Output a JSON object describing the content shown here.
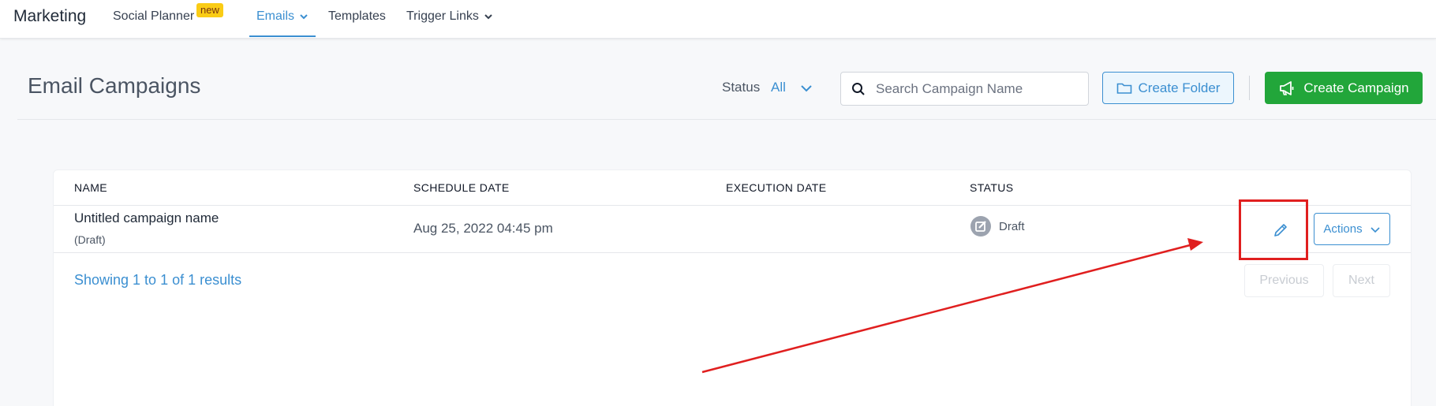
{
  "nav": {
    "brand": "Marketing",
    "items": [
      {
        "label": "Social Planner",
        "badge": "new"
      },
      {
        "label": "Emails",
        "active": true
      },
      {
        "label": "Templates"
      },
      {
        "label": "Trigger Links"
      }
    ],
    "accent_color": "#3b8fd1"
  },
  "header": {
    "title": "Email Campaigns",
    "status_label": "Status",
    "status_value": "All",
    "search_placeholder": "Search Campaign Name",
    "create_folder_label": "Create Folder",
    "create_campaign_label": "Create Campaign",
    "create_campaign_color": "#22a63a"
  },
  "table": {
    "columns": [
      "NAME",
      "SCHEDULE DATE",
      "EXECUTION DATE",
      "STATUS"
    ],
    "rows": [
      {
        "name": "Untitled campaign name",
        "sub": "(Draft)",
        "schedule_date": "Aug 25, 2022 04:45 pm",
        "execution_date": "",
        "status": "Draft",
        "status_icon": "edit-square-icon",
        "edit_icon": "pencil-icon",
        "actions_label": "Actions"
      }
    ],
    "showing_text": "Showing 1 to 1 of 1 results",
    "previous_label": "Previous",
    "next_label": "Next"
  },
  "annotation": {
    "color": "#e01f1f",
    "target": "edit-button"
  }
}
